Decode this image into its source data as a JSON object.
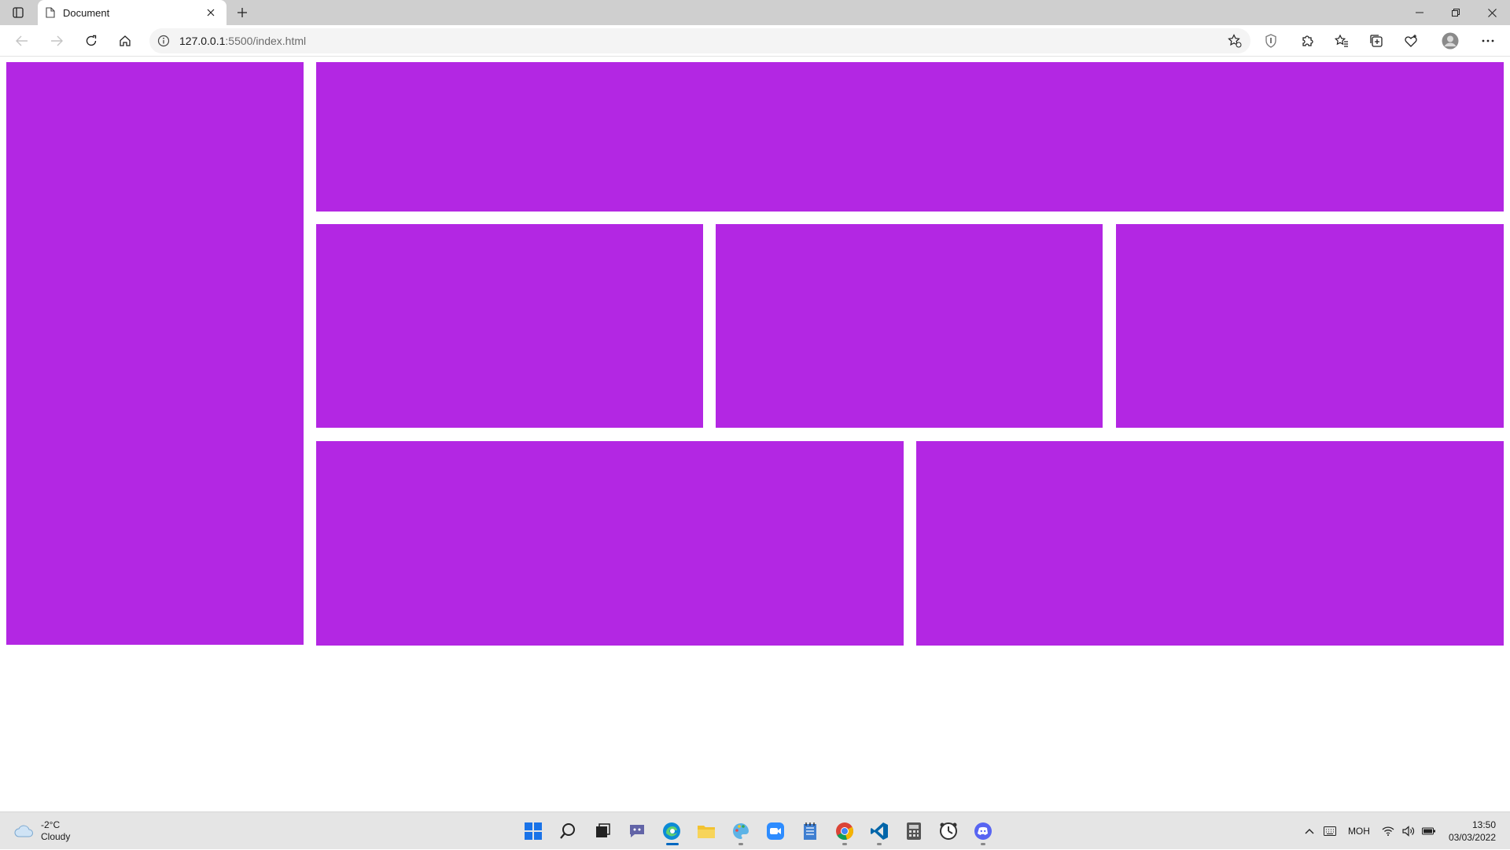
{
  "browser": {
    "tab_title": "Document",
    "url_host": "127.0.0.1",
    "url_path": ":5500/index.html"
  },
  "page": {
    "box_color": "#b327e3",
    "box_count": 7
  },
  "taskbar": {
    "weather_temp": "-2°C",
    "weather_desc": "Cloudy",
    "language": "MOH",
    "time": "13:50",
    "date": "03/03/2022",
    "apps": [
      "start-icon",
      "search-icon",
      "task-view-icon",
      "teams-icon",
      "edge-icon",
      "file-explorer-icon",
      "paint-icon",
      "zoom-icon",
      "notepad-icon",
      "chrome-icon",
      "vscode-icon",
      "calculator-icon",
      "clock-icon",
      "discord-icon"
    ]
  }
}
